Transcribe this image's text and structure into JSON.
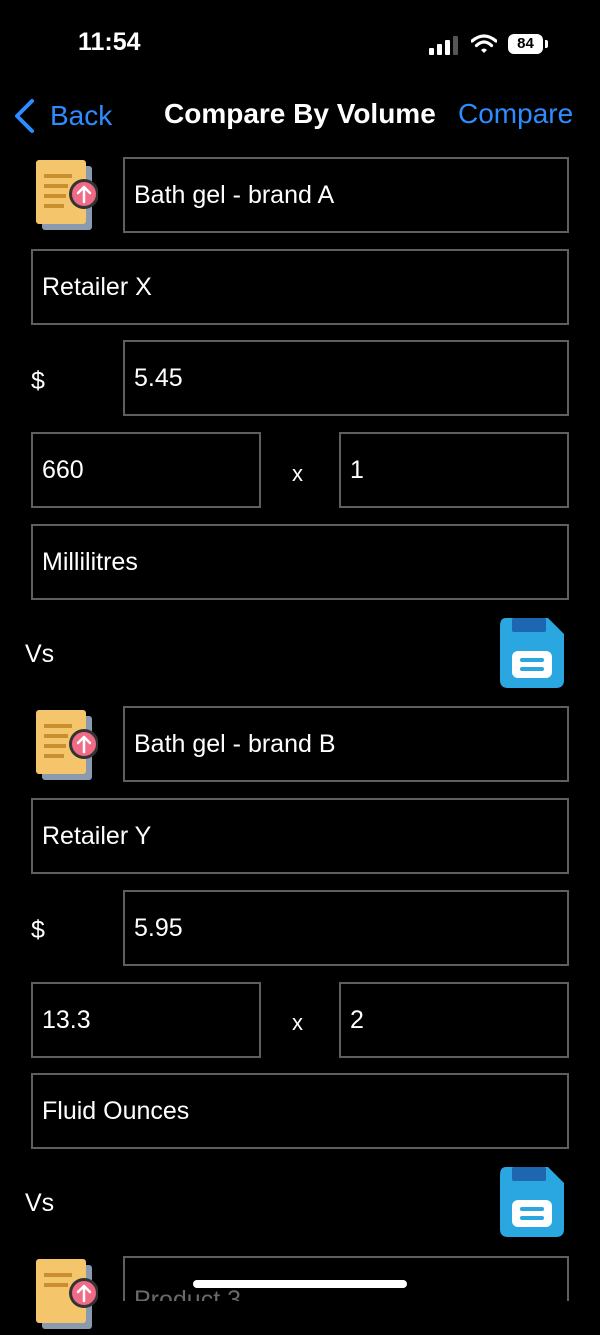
{
  "status_bar": {
    "time": "11:54",
    "battery": "84"
  },
  "nav": {
    "back_label": "Back",
    "title": "Compare By Volume",
    "action_label": "Compare"
  },
  "currency_symbol": "$",
  "multiply_symbol": "x",
  "vs_label": "Vs",
  "products": [
    {
      "name": "Bath gel - brand A",
      "retailer": "Retailer X",
      "price": "5.45",
      "quantity": "660",
      "count": "1",
      "unit": "Millilitres"
    },
    {
      "name": "Bath gel - brand B",
      "retailer": "Retailer Y",
      "price": "5.95",
      "quantity": "13.3",
      "count": "2",
      "unit": "Fluid Ounces"
    },
    {
      "name_placeholder": "Product 3"
    }
  ],
  "colors": {
    "accent": "#2d8cff",
    "field_border": "#5f5f5f",
    "save_icon": "#2aa6e0",
    "doc_icon": "#f5c56b",
    "doc_badge": "#ef6b86"
  }
}
